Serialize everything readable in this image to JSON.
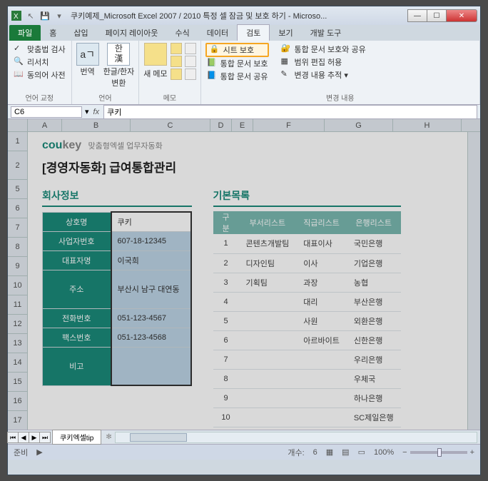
{
  "window": {
    "title": "쿠키예제_Microsoft Excel 2007 / 2010 특정 셀 잠금 및 보호 하기 - Microso..."
  },
  "tabs": {
    "file": "파일",
    "list": [
      "홈",
      "삽입",
      "페이지 레이아웃",
      "수식",
      "데이터",
      "검토",
      "보기",
      "개발 도구"
    ]
  },
  "ribbon": {
    "g1": {
      "b1": "맞춤법 검사",
      "b2": "리서치",
      "b3": "동의어 사전",
      "label": "언어 교정"
    },
    "g2": {
      "b1": "번역",
      "b2": "한글/한자\n변환",
      "label": "언어"
    },
    "g3": {
      "b1": "새 메모",
      "label": "메모"
    },
    "g4": {
      "protect_sheet": "시트 보호",
      "protect_wb": "통합 문서 보호",
      "share_wb": "통합 문서 공유",
      "share_protect": "통합 문서 보호와 공유",
      "allow_ranges": "범위 편집 허용",
      "track_changes": "변경 내용 추적",
      "label": "변경 내용"
    }
  },
  "namebox": {
    "cell": "C6",
    "value": "쿠키"
  },
  "cols": [
    "A",
    "B",
    "C",
    "D",
    "E",
    "F",
    "G",
    "H"
  ],
  "rows": [
    "1",
    "2",
    "5",
    "6",
    "7",
    "8",
    "9",
    "10",
    "11",
    "12",
    "13",
    "14",
    "15",
    "16",
    "17"
  ],
  "doc": {
    "brand_cou": "cou",
    "brand_key": "key",
    "brand_sub": "맞춤형엑셀 업무자동화",
    "h1": "[경영자동화] 급여통합관리",
    "sec1": "회사정보",
    "sec2": "기본목록"
  },
  "info": [
    {
      "label": "상호명",
      "val": "쿠키"
    },
    {
      "label": "사업자번호",
      "val": "607-18-12345"
    },
    {
      "label": "대표자명",
      "val": "이국희"
    },
    {
      "label": "주소",
      "val": "부산시 남구 대연동"
    },
    {
      "label": "전화번호",
      "val": "051-123-4567"
    },
    {
      "label": "팩스번호",
      "val": "051-123-4568"
    },
    {
      "label": "비고",
      "val": ""
    }
  ],
  "list": {
    "headers": [
      "구분",
      "부서리스트",
      "직급리스트",
      "은행리스트"
    ],
    "rows": [
      [
        "1",
        "콘텐츠개발팀",
        "대표이사",
        "국민은행"
      ],
      [
        "2",
        "디자인팀",
        "이사",
        "기업은행"
      ],
      [
        "3",
        "기획팀",
        "과장",
        "농협"
      ],
      [
        "4",
        "",
        "대리",
        "부산은행"
      ],
      [
        "5",
        "",
        "사원",
        "외환은행"
      ],
      [
        "6",
        "",
        "아르바이트",
        "신한은행"
      ],
      [
        "7",
        "",
        "",
        "우리은행"
      ],
      [
        "8",
        "",
        "",
        "우체국"
      ],
      [
        "9",
        "",
        "",
        "하나은행"
      ],
      [
        "10",
        "",
        "",
        "SC제일은행"
      ]
    ]
  },
  "sheettab": "쿠키엑셀tip",
  "status": {
    "ready": "준비",
    "count_label": "개수:",
    "count": "6",
    "zoom": "100%"
  }
}
